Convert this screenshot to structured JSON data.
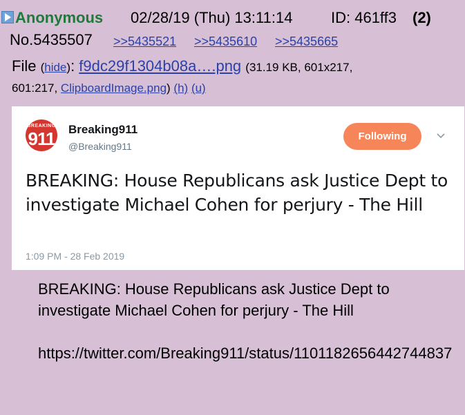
{
  "post": {
    "name": "Anonymous",
    "date": "02/28/19 (Thu) 13:11:14",
    "id": "ID: 461ff3",
    "reply_count": "(2)",
    "number": "No.5435507",
    "backlinks": [
      ">>5435521",
      ">>5435610",
      ">>5435665"
    ]
  },
  "file": {
    "label": "File",
    "hide": "hide",
    "name": "f9dc29f1304b08a….png",
    "info": "(31.19 KB, 601x217,",
    "info2": "601:217,",
    "original_name": "ClipboardImage.png",
    "h": "(h)",
    "u": "(u)"
  },
  "tweet": {
    "avatar_text_top": "BREAKING",
    "avatar_text_num": "911",
    "name": "Breaking911",
    "handle": "@Breaking911",
    "follow_label": "Following",
    "text": "BREAKING: House Republicans ask Justice Dept to investigate Michael Cohen for perjury - The Hill",
    "time": "1:09 PM - 28 Feb 2019",
    "colors": {
      "follow_bg": "#f6855a",
      "avatar_bg": "#d4372f"
    }
  },
  "body": {
    "line1": "BREAKING: House Republicans ask Justice Dept to investigate Michael Cohen for perjury - The Hill",
    "url": "https://twitter.com/Breaking911/status/1101182656442744837"
  },
  "colors": {
    "background": "#d7bfd5",
    "name": "#1f7b3a",
    "link": "#2b41a8"
  }
}
